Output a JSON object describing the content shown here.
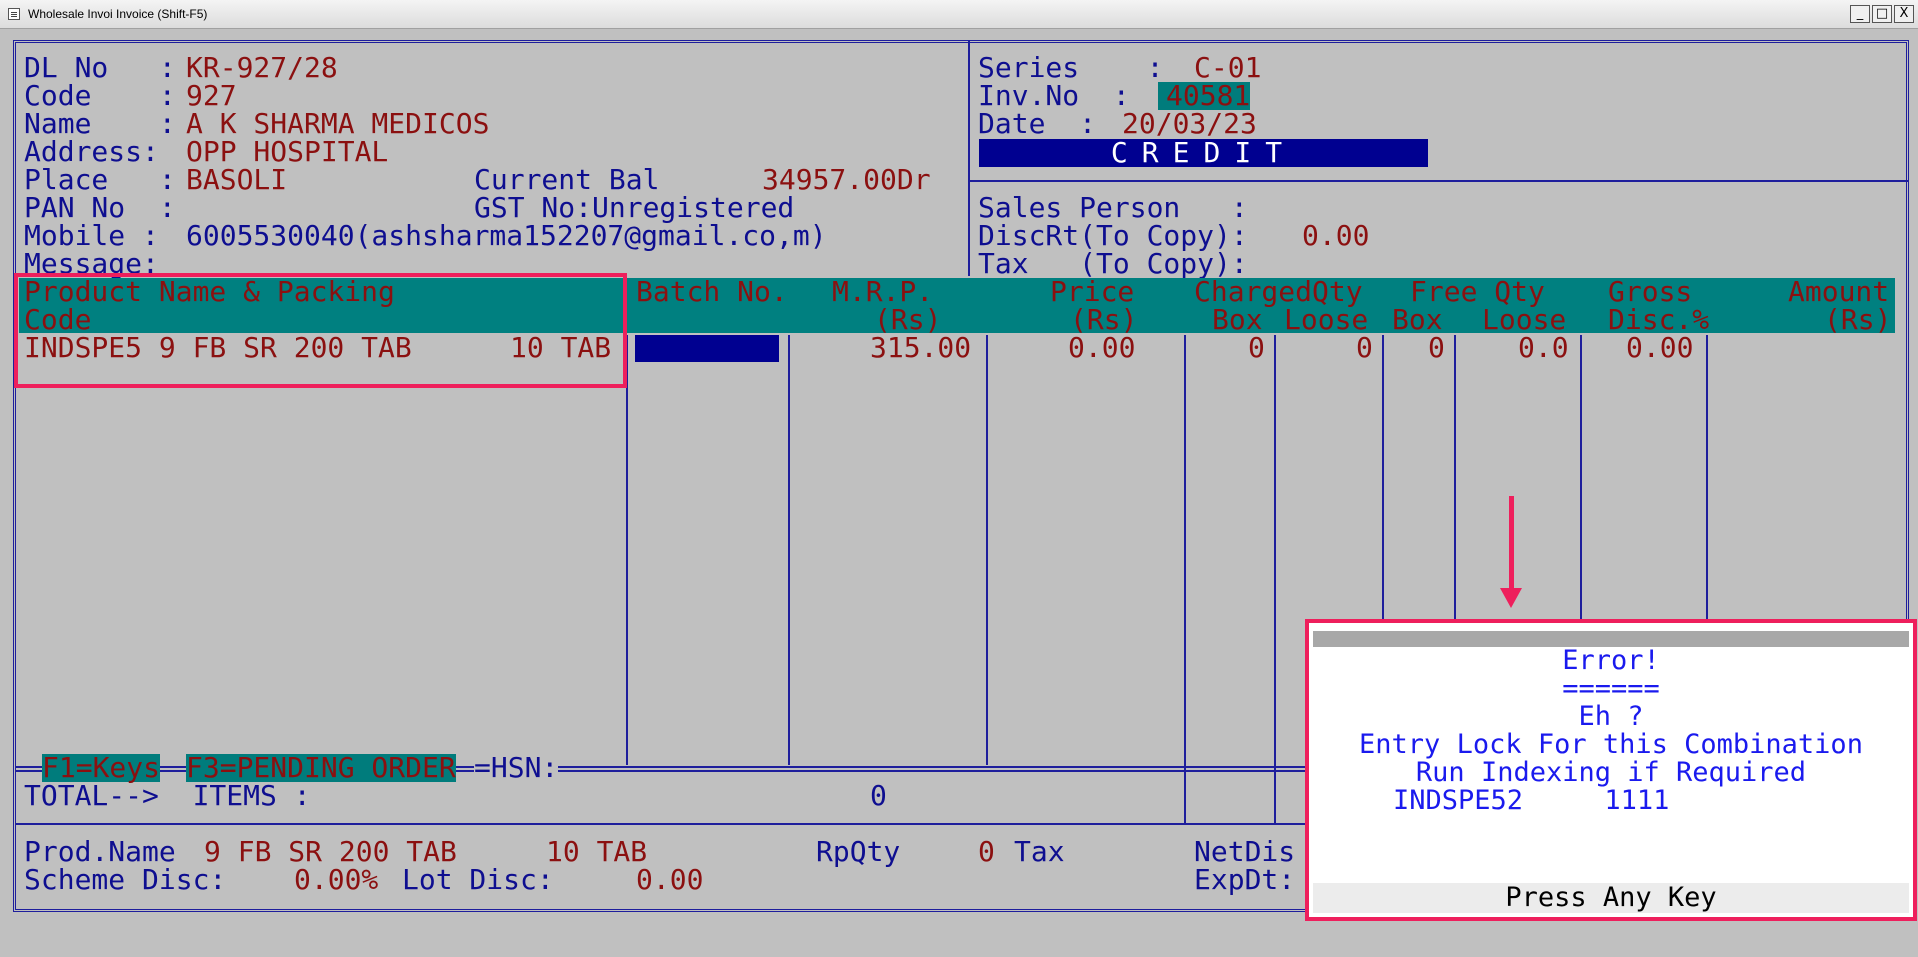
{
  "window": {
    "title": "Wholesale Invoi Invoice (Shift-F5)",
    "minimize": "_",
    "maximize": "□",
    "close": "X"
  },
  "party": {
    "dl_label": "DL No   :",
    "dl_value": "KR-927/28",
    "code_label": "Code    :",
    "code_value": "927",
    "name_label": "Name    :",
    "name_value": "A K SHARMA MEDICOS",
    "address_label": "Address:",
    "address_value": "OPP HOSPITAL",
    "place_label": "Place   :",
    "place_value": "BASOLI",
    "curbal_label": "Current Bal",
    "curbal_value": "34957.00Dr",
    "pan_label": "PAN No  :",
    "gst_label": "GST No:Unregistered",
    "mobile_label": "Mobile :",
    "mobile_value": "6005530040(ashsharma152207@gmail.co,m)",
    "message_label": "Message:"
  },
  "invoice": {
    "series_label": "Series    :",
    "series_value": "C-01",
    "invno_label": "Inv.No  :",
    "invno_value": "40581",
    "date_label": "Date  :",
    "date_value": "20/03/23",
    "mode": "CREDIT",
    "salesperson_label": "Sales Person   :",
    "discrt_label": "DiscRt(To Copy):",
    "discrt_value": "0.00",
    "tax_label": "Tax   (To Copy):"
  },
  "columns": {
    "product": "Product Name & Packing",
    "code": "Code",
    "batch": "Batch No.",
    "mrp": "M.R.P.",
    "mrp_unit": "(Rs)",
    "price": "Price",
    "price_unit": "(Rs)",
    "charged": "ChargedQty",
    "charged_box": "Box",
    "charged_loose": "Loose",
    "free": "Free Qty",
    "free_box": "Box",
    "free_loose": "Loose",
    "gross": "Gross",
    "disc": "Disc.%",
    "amount": "Amount",
    "amount_unit": "(Rs)"
  },
  "row": {
    "product": "INDSPE5 9 FB SR 200 TAB",
    "packing": "10 TAB",
    "mrp": "315.00",
    "price": "0.00",
    "charged_box": "0",
    "charged_loose": "0",
    "free_box": "0",
    "free_loose": "0.0",
    "disc": "0.00"
  },
  "footer": {
    "f1": "F1=Keys",
    "f3": "F3=PENDING ORDER",
    "hsn": "=HSN:",
    "total_label": "TOTAL-->  ITEMS :",
    "total_items": "0",
    "prodname_label": "Prod.Name",
    "prodname_value": "9 FB SR 200 TAB",
    "prodname_pack": "10 TAB",
    "rpqty_label": "RpQty",
    "rpqty_value": "0",
    "tax_label": "Tax",
    "netdis_label": "NetDis",
    "scheme_label": "Scheme Disc:",
    "scheme_value": "0.00%",
    "lot_label": "Lot Disc:",
    "lot_value": "0.00",
    "expdt_label": "ExpDt:"
  },
  "dialog": {
    "title": "Error!",
    "underline": "======",
    "line1": "Eh ?",
    "line2": "Entry Lock For this Combination",
    "line3": "Run Indexing if Required",
    "line4": "INDSPE52     1111",
    "footer": "Press Any Key"
  }
}
